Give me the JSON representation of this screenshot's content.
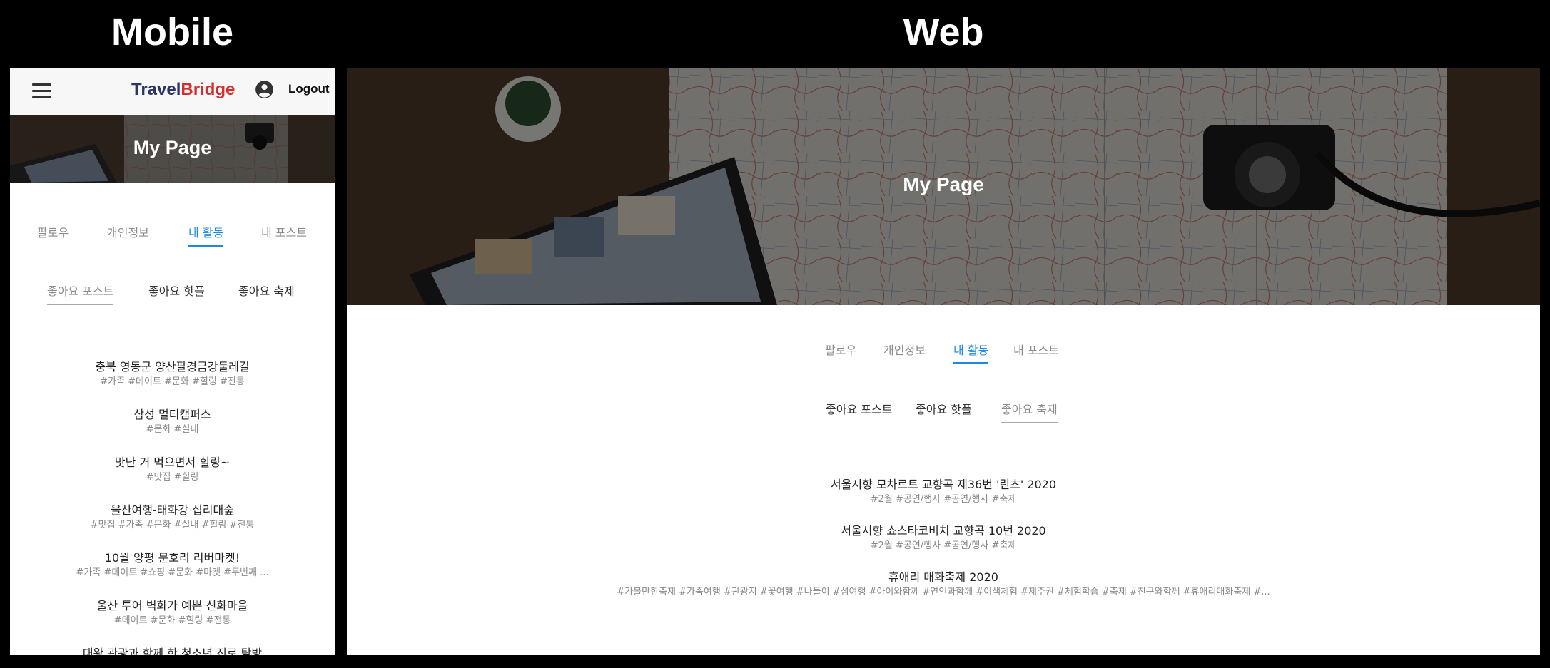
{
  "labels": {
    "mobile": "Mobile",
    "web": "Web"
  },
  "mobile": {
    "appbar": {
      "menu_icon": "hamburger-menu-icon",
      "logo_part1": "Travel",
      "logo_part2": "Bridge",
      "account_icon": "account-circle-icon",
      "logout_label": "Logout"
    },
    "hero_title": "My Page",
    "tabs": [
      {
        "label": "팔로우",
        "active": false
      },
      {
        "label": "개인정보",
        "active": false
      },
      {
        "label": "내 활동",
        "active": true
      },
      {
        "label": "내 포스트",
        "active": false
      }
    ],
    "subtabs": [
      {
        "label": "좋아요 포스트",
        "active": true
      },
      {
        "label": "좋아요 핫플",
        "active": false
      },
      {
        "label": "좋아요 축제",
        "active": false
      }
    ],
    "items": [
      {
        "title": "충북 영동군 양산팔경금강둘레길",
        "tags": "#가족 #데이트 #문화 #힐링 #전통"
      },
      {
        "title": "삼성 멀티캠퍼스",
        "tags": "#문화 #실내"
      },
      {
        "title": "맛난 거 먹으면서 힐링~",
        "tags": "#맛집 #힐링"
      },
      {
        "title": "울산여행-태화강 십리대숲",
        "tags": "#맛집 #가족 #문화 #실내 #힐링 #전통"
      },
      {
        "title": "10월 양평 문호리 리버마켓!",
        "tags": "#가족 #데이트 #쇼핑 #문화 #마켓 #두번째 ..."
      },
      {
        "title": "울산 투어 벽화가 예쁜 신화마을",
        "tags": "#데이트 #문화 #힐링 #전통"
      },
      {
        "title": "대왕 관광과 함께 한 청소년 진로 탐방",
        "tags": ""
      }
    ]
  },
  "web": {
    "hero_title": "My Page",
    "tabs": [
      {
        "label": "팔로우",
        "active": false
      },
      {
        "label": "개인정보",
        "active": false
      },
      {
        "label": "내 활동",
        "active": true
      },
      {
        "label": "내 포스트",
        "active": false
      }
    ],
    "subtabs": [
      {
        "label": "좋아요 포스트",
        "active": false
      },
      {
        "label": "좋아요 핫플",
        "active": false
      },
      {
        "label": "좋아요 축제",
        "active": true
      }
    ],
    "items": [
      {
        "title": "서울시향 모차르트 교향곡 제36번 '린츠' 2020",
        "tags": "#2월 #공연/행사 #공연/행사 #축제"
      },
      {
        "title": "서울시향 쇼스타코비치 교향곡 10번 2020",
        "tags": "#2월 #공연/행사 #공연/행사 #축제"
      },
      {
        "title": "휴애리 매화축제 2020",
        "tags": "#가볼만한축제 #가족여행 #관광지 #꽃여행 #나들이 #섬여행 #아이와함께 #연인과함께 #이색체험 #제주권 #체험학습 #축제 #친구와함께 #휴애리매화축제 #..."
      }
    ]
  },
  "colors": {
    "brand_navy": "#2a3568",
    "brand_red": "#d32f2f",
    "active_tab": "#1e88e5"
  }
}
